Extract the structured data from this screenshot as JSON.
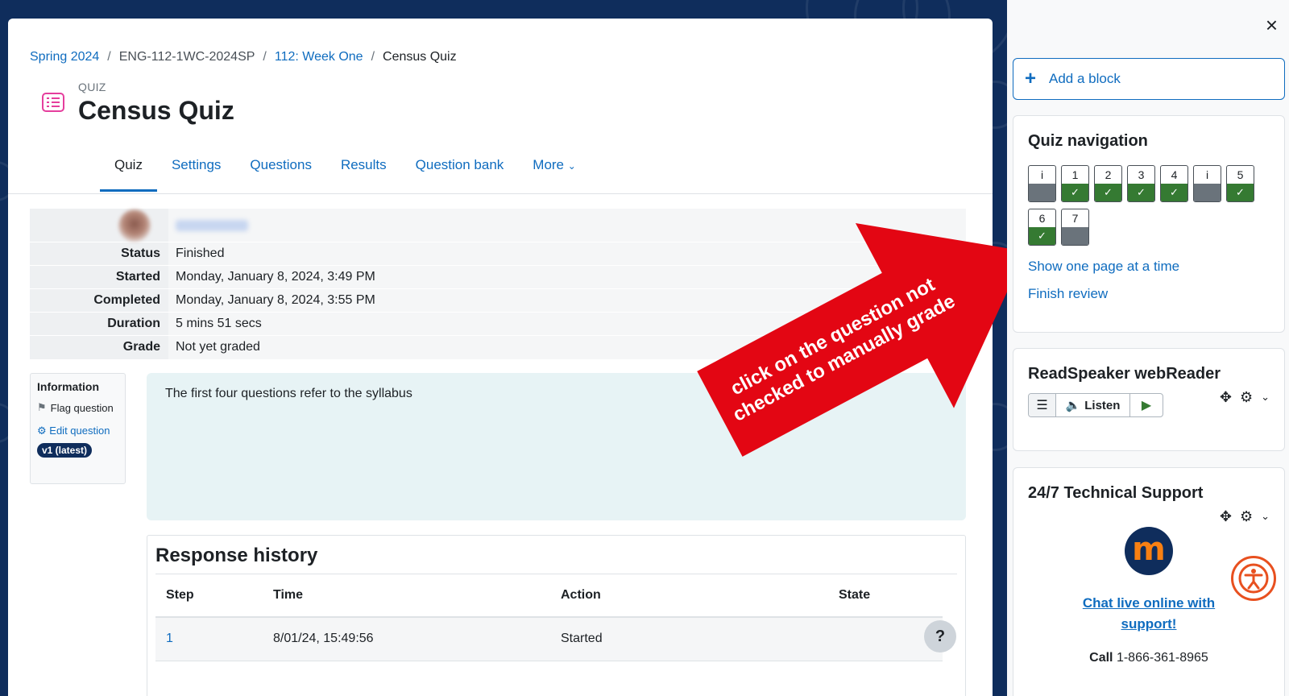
{
  "breadcrumb": {
    "item1": "Spring 2024",
    "item2": "ENG-112-1WC-2024SP",
    "item3": "112: Week One",
    "current": "Census Quiz"
  },
  "activity": {
    "label": "QUIZ",
    "title": "Census Quiz"
  },
  "tabs": [
    {
      "label": "Quiz"
    },
    {
      "label": "Settings"
    },
    {
      "label": "Questions"
    },
    {
      "label": "Results"
    },
    {
      "label": "Question bank"
    },
    {
      "label": "More"
    }
  ],
  "summary": {
    "status_label": "Status",
    "status": "Finished",
    "started_label": "Started",
    "started": "Monday, January 8, 2024, 3:49 PM",
    "completed_label": "Completed",
    "completed": "Monday, January 8, 2024, 3:55 PM",
    "duration_label": "Duration",
    "duration": "5 mins 51 secs",
    "grade_label": "Grade",
    "grade": "Not yet graded"
  },
  "info": {
    "title": "Information",
    "flag": "Flag question",
    "edit": "Edit question",
    "version": "v1 (latest)"
  },
  "question_text": "The first four questions refer to the syllabus",
  "history": {
    "title": "Response history",
    "columns": [
      "Step",
      "Time",
      "Action",
      "State"
    ],
    "rows": [
      {
        "step": "1",
        "time": "8/01/24, 15:49:56",
        "action": "Started",
        "state": ""
      }
    ]
  },
  "help": "?",
  "annotation": {
    "line1": "click on the question not",
    "line2": "checked to manually grade",
    "color": "#e30613"
  },
  "drawer": {
    "close": "×",
    "add_block": "Add a block",
    "quiz_nav": {
      "title": "Quiz navigation",
      "buttons": [
        {
          "label": "i",
          "state": "grey"
        },
        {
          "label": "1",
          "state": "green"
        },
        {
          "label": "2",
          "state": "green"
        },
        {
          "label": "3",
          "state": "green"
        },
        {
          "label": "4",
          "state": "green"
        },
        {
          "label": "i",
          "state": "grey"
        },
        {
          "label": "5",
          "state": "green"
        },
        {
          "label": "6",
          "state": "green"
        },
        {
          "label": "7",
          "state": "grey"
        }
      ],
      "show_one_page": "Show one page at a time",
      "finish_review": "Finish review"
    },
    "readspeaker": {
      "title": "ReadSpeaker webReader",
      "listen": "Listen"
    },
    "support": {
      "title": "24/7 Technical Support",
      "chat_line1": "Chat live online with",
      "chat_line2": "support!",
      "call_label": "Call",
      "phone": "1-866-361-8965"
    }
  },
  "colors": {
    "brand": "#0f6cbf",
    "navy": "#0f2d5c",
    "correct": "#357a32",
    "arrow": "#e30613"
  }
}
